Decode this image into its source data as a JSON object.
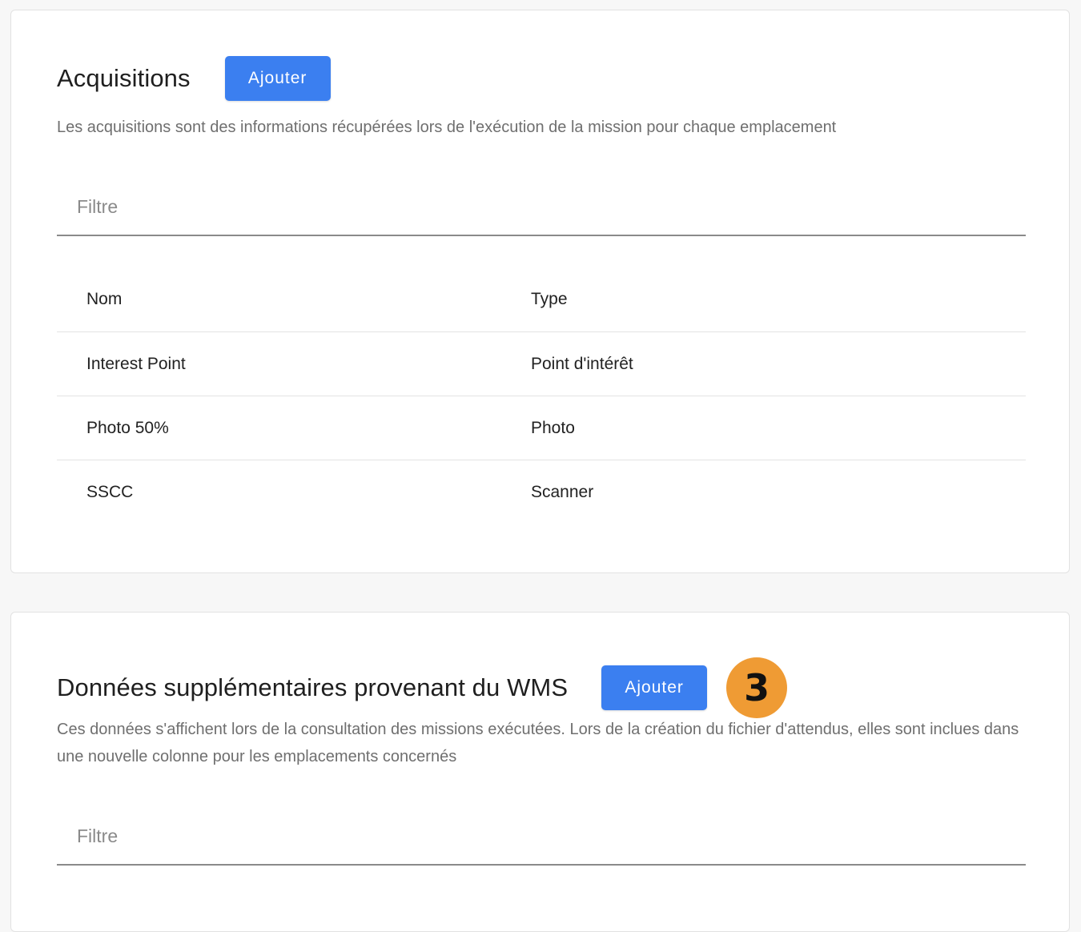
{
  "acquisitions": {
    "title": "Acquisitions",
    "add_label": "Ajouter",
    "description": "Les acquisitions sont des informations récupérées lors de l'exécution de la mission pour chaque emplacement",
    "filter_placeholder": "Filtre",
    "columns": [
      "Nom",
      "Type"
    ],
    "rows": [
      {
        "name": "Interest Point",
        "type": "Point d'intérêt"
      },
      {
        "name": "Photo 50%",
        "type": "Photo"
      },
      {
        "name": "SSCC",
        "type": "Scanner"
      }
    ]
  },
  "wms_data": {
    "title": "Données supplémentaires provenant du WMS",
    "add_label": "Ajouter",
    "step_badge": "3",
    "description": "Ces données s'affichent lors de la consultation des missions exécutées. Lors de la création du fichier d'attendus, elles sont inclues dans une nouvelle colonne pour les emplacements concernés",
    "filter_placeholder": "Filtre"
  },
  "colors": {
    "accent": "#3b7ff0",
    "badge": "#ef9b34"
  }
}
